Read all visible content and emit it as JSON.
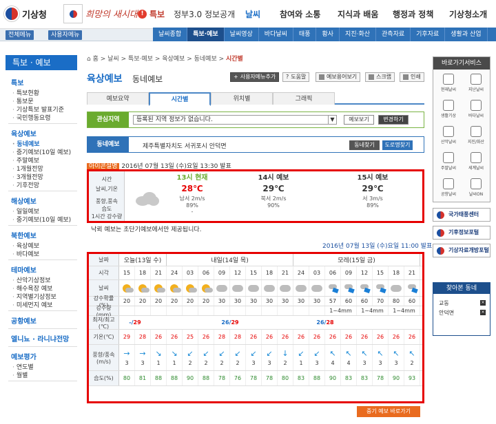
{
  "header": {
    "org": "기상청",
    "slogan": "희망의 새시대",
    "tukbo": "특보",
    "gov": "정부3.0 정보공개",
    "gnb": [
      "날씨",
      "참여와 소통",
      "지식과 배움",
      "행정과 정책",
      "기상청소개"
    ]
  },
  "subnav": {
    "all_menu": "전체메뉴",
    "user_menu": "사용자메뉴",
    "tabs": [
      "날씨종합",
      "특보·예보",
      "날씨영상",
      "바다날씨",
      "태풍",
      "황사",
      "지진·화산",
      "관측자료",
      "기후자료",
      "생활과 산업"
    ]
  },
  "lnb": {
    "title": "특보 · 예보",
    "groups": [
      {
        "h": "특보",
        "items": [
          "특보현황",
          "통보문",
          "기상특보 발표기준",
          "국민행동요령"
        ]
      },
      {
        "h": "육상예보",
        "items": [
          "동네예보",
          "중기예보(10일 예보)",
          "주말예보",
          "1개월전망",
          "3개월전망",
          "기후전망"
        ]
      },
      {
        "h": "해상예보",
        "items": [
          "일일예보",
          "중기예보(10일 예보)"
        ]
      },
      {
        "h": "북한예보",
        "items": [
          "육상예보",
          "바다예보"
        ]
      },
      {
        "h": "테마예보",
        "items": [
          "산악기상정보",
          "해수욕장 예보",
          "지역별기상정보",
          "미세먼지 예보"
        ]
      },
      {
        "h": "공항예보",
        "items": []
      },
      {
        "h": "엘니뇨 · 라니냐전망",
        "items": []
      },
      {
        "h": "예보평가",
        "items": [
          "연도별",
          "월별"
        ]
      }
    ]
  },
  "crumb": [
    "홈",
    "날씨",
    "특보·예보",
    "육상예보",
    "동네예보",
    "시간별"
  ],
  "page": {
    "title": "육상예보",
    "subtitle": "동네예보",
    "add_menu": "사용자메뉴추가",
    "help": "도움말",
    "view": "예보용어보기",
    "scrap": "스크랩",
    "print": "인쇄"
  },
  "tabs": [
    "예보요약",
    "시간별",
    "위치별",
    "그래픽"
  ],
  "interest": {
    "label": "관심지역",
    "placeholder": "등록된 지역 정보가 없습니다.",
    "btn1": "예보보기",
    "btn2": "변경하기"
  },
  "dong": {
    "label": "동네예보",
    "location": "제주특별자치도 서귀포시 안덕면",
    "btn1": "동네찾기",
    "btn2": "도로명찾기"
  },
  "announce": {
    "tag": "아이콘설명",
    "text": "2016년 07월 13일 (수)요일 13:30 발표"
  },
  "current": {
    "labels": [
      "시간",
      "날씨,기온",
      "풍향,풍속",
      "습도",
      "1시간 강수량"
    ],
    "slots": [
      {
        "hour": "13시 현재",
        "temp": "28℃",
        "wind": "남서 2m/s",
        "hum": "89%",
        "rain": "-"
      },
      {
        "hour": "14시 예보",
        "temp": "29℃",
        "wind": "북서 2m/s",
        "hum": "90%"
      },
      {
        "hour": "15시 예보",
        "temp": "29℃",
        "wind": "서 3m/s",
        "hum": "89%"
      }
    ]
  },
  "note": "낙뢰 예보는 초단기예보에서만 제공됩니다.",
  "issue2": "2016년 07월 13일 (수)요일 11:00 발표",
  "grid": {
    "labels": {
      "date": "날짜",
      "hour": "시각",
      "weather": "날씨",
      "pop": "강수확률(%)",
      "rain": "강수량(mm)",
      "minmax": "최저/최고(℃)",
      "temp": "기온(℃)",
      "wind": "풍향/풍속(m/s)",
      "hum": "습도(%)"
    },
    "days": [
      "오늘(13일 수)",
      "내일(14일 목)",
      "모레(15일 금)"
    ],
    "hours": [
      "15",
      "18",
      "21",
      "24",
      "03",
      "06",
      "09",
      "12",
      "15",
      "18",
      "21",
      "24",
      "03",
      "06",
      "09",
      "12",
      "15",
      "18",
      "21"
    ],
    "weather": [
      "sun",
      "sun",
      "sun",
      "sun",
      "sun",
      "sun",
      "cld",
      "cld",
      "cld",
      "cld",
      "cld",
      "cld",
      "cld",
      "rain",
      "rain",
      "rain",
      "rain",
      "cld",
      "rain"
    ],
    "pop": [
      "20",
      "20",
      "20",
      "20",
      "20",
      "20",
      "30",
      "30",
      "30",
      "30",
      "30",
      "30",
      "30",
      "57",
      "60",
      "60",
      "70",
      "80",
      "60"
    ],
    "rain": [
      "",
      "",
      "",
      "",
      "",
      "",
      "",
      "",
      "",
      "",
      "",
      "",
      "",
      "1~4mm",
      "",
      "1~4mm",
      "",
      "1~4mm",
      ""
    ],
    "minmax": [
      "-/29",
      "",
      "",
      "",
      "",
      "",
      "26/29",
      "",
      "",
      "",
      "",
      "",
      "26/28",
      "",
      "",
      "",
      "",
      "",
      ""
    ],
    "temp": [
      "29",
      "28",
      "26",
      "26",
      "25",
      "26",
      "28",
      "28",
      "26",
      "26",
      "26",
      "26",
      "26",
      "26",
      "26",
      "26",
      "26",
      "26",
      "26"
    ],
    "wind_dir": [
      "→",
      "→",
      "↘",
      "↘",
      "↙",
      "↙",
      "↙",
      "↙",
      "↙",
      "↙",
      "↓",
      "↙",
      "↙",
      "↖",
      "↖",
      "↖",
      "↖",
      "↖",
      "↖"
    ],
    "wind": [
      "3",
      "3",
      "1",
      "1",
      "2",
      "2",
      "2",
      "2",
      "3",
      "3",
      "2",
      "1",
      "3",
      "4",
      "4",
      "3",
      "3",
      "3",
      "2"
    ],
    "hum": [
      "80",
      "81",
      "88",
      "88",
      "90",
      "88",
      "78",
      "76",
      "78",
      "78",
      "80",
      "83",
      "88",
      "90",
      "83",
      "83",
      "78",
      "90",
      "93"
    ]
  },
  "right": {
    "title": "바로가기서비스",
    "items": [
      "현재날씨",
      "지난날씨",
      "생활기상",
      "바다날씨",
      "산악날씨",
      "지진/화산",
      "주말날씨",
      "세계날씨",
      "공항날씨",
      "날씨ON"
    ],
    "banners": [
      "국가태풍센터",
      "기후정보포털",
      "기상자료개방포털"
    ]
  },
  "fav": {
    "title": "찾아본 동네",
    "items": [
      "교동",
      "안덕면"
    ]
  },
  "mid_btn": "중기 예보 바로가기"
}
